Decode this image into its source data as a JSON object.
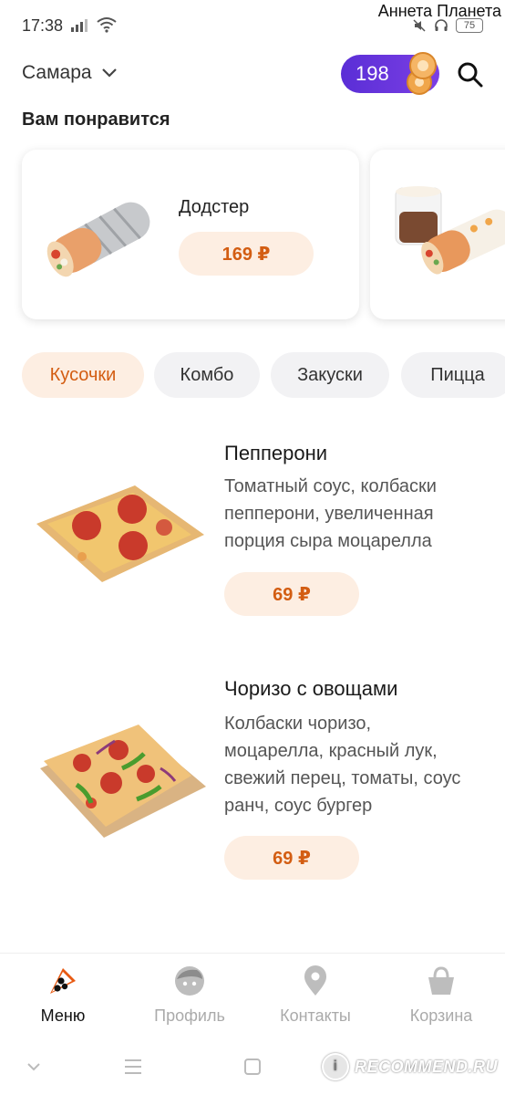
{
  "status_bar": {
    "time": "17:38",
    "battery": "75",
    "watermark": "Аннета Планета"
  },
  "header": {
    "city": "Самара",
    "coins": "198"
  },
  "recommend": {
    "title": "Вам понравится",
    "cards": [
      {
        "name": "Додстер",
        "price": "169 ₽"
      },
      {
        "name": "",
        "price": ""
      }
    ]
  },
  "tabs": [
    {
      "label": "Кусочки",
      "active": true
    },
    {
      "label": "Комбо",
      "active": false
    },
    {
      "label": "Закуски",
      "active": false
    },
    {
      "label": "Пицца",
      "active": false
    }
  ],
  "products": [
    {
      "name": "Пепперони",
      "description_lines": [
        "Томатный соус, колбаски",
        "пепперони, увеличенная",
        "порция сыра моцарелла"
      ],
      "price": "69 ₽"
    },
    {
      "name": "Чоризо с овощами",
      "description_lines": [
        "Колбаски чоризо,",
        "моцарелла, красный лук,",
        "свежий перец, томаты, соус",
        "ранч, соус бургер"
      ],
      "price": "69 ₽"
    }
  ],
  "bottom_nav": [
    {
      "label": "Меню",
      "icon": "pizza-slice-icon",
      "active": true
    },
    {
      "label": "Профиль",
      "icon": "profile-face-icon",
      "active": false
    },
    {
      "label": "Контакты",
      "icon": "location-pin-icon",
      "active": false
    },
    {
      "label": "Корзина",
      "icon": "shopping-basket-icon",
      "active": false
    }
  ],
  "android_bar": {
    "logo_text": "RECOMMEND.RU"
  },
  "colors": {
    "accent": "#d35d12",
    "accent_bg": "#fdeee2",
    "coin_badge": "#6a35dd",
    "tab_bg": "#f2f2f4"
  }
}
